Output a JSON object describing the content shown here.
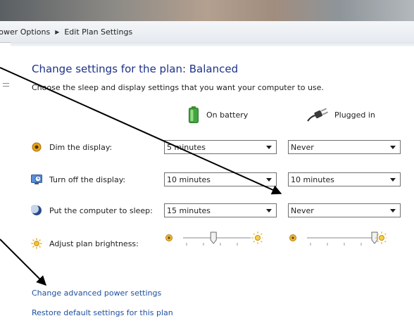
{
  "breadcrumb": {
    "items": [
      "Power Options",
      "Edit Plan Settings"
    ]
  },
  "heading": "Change settings for the plan: Balanced",
  "subtitle": "Choose the sleep and display settings that you want your computer to use.",
  "columns": {
    "on_battery": "On battery",
    "plugged_in": "Plugged in"
  },
  "rows": {
    "dim": {
      "label": "Dim the display:",
      "on_battery": "5 minutes",
      "plugged_in": "Never"
    },
    "turn_off": {
      "label": "Turn off the display:",
      "on_battery": "10 minutes",
      "plugged_in": "10 minutes"
    },
    "sleep": {
      "label": "Put the computer to sleep:",
      "on_battery": "15 minutes",
      "plugged_in": "Never"
    },
    "brightness": {
      "label": "Adjust plan brightness:",
      "on_battery_level": 0.45,
      "plugged_in_level": 1.0
    }
  },
  "links": {
    "advanced": "Change advanced power settings",
    "restore": "Restore default settings for this plan"
  },
  "colors": {
    "heading": "#1e3287",
    "link": "#1e50a0",
    "annotation_arrow": "#000000"
  }
}
